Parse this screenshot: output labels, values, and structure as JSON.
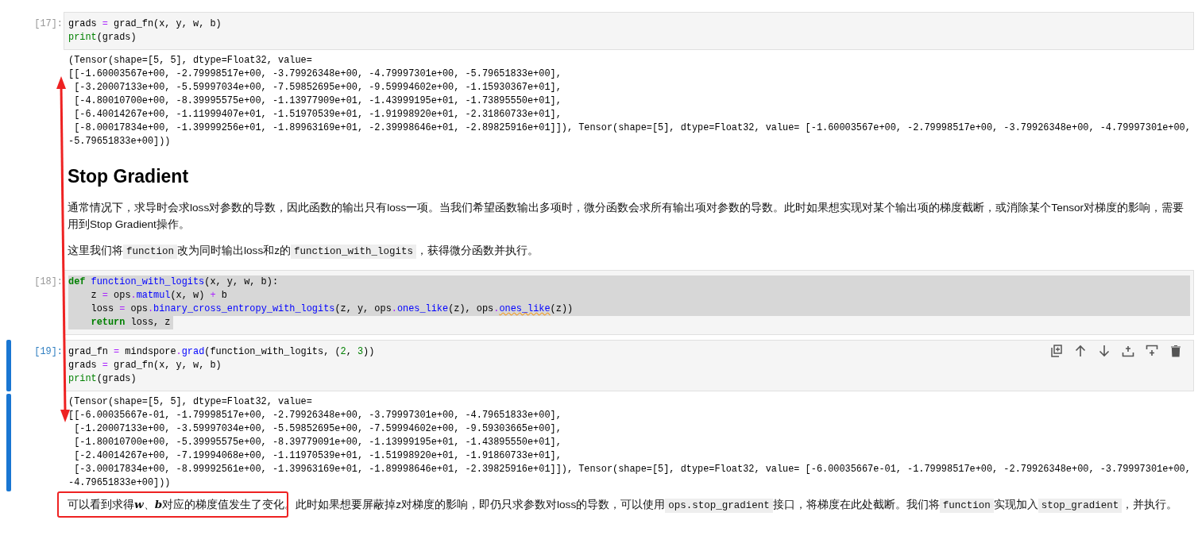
{
  "cells": [
    {
      "kind": "code",
      "prompt": "[17]:",
      "selected": false,
      "text_highlighted": false,
      "lines": [
        [
          {
            "kind": "plain",
            "t": "grads "
          },
          {
            "kind": "op",
            "t": "="
          },
          {
            "kind": "plain",
            "t": " grad_fn(x, y, w, b)"
          }
        ],
        [
          {
            "kind": "builtin",
            "t": "print"
          },
          {
            "kind": "plain",
            "t": "(grads)"
          }
        ]
      ],
      "output": "(Tensor(shape=[5, 5], dtype=Float32, value=\n[[-1.60003567e+00, -2.79998517e+00, -3.79926348e+00, -4.79997301e+00, -5.79651833e+00],\n [-3.20007133e+00, -5.59997034e+00, -7.59852695e+00, -9.59994602e+00, -1.15930367e+01],\n [-4.80010700e+00, -8.39995575e+00, -1.13977909e+01, -1.43999195e+01, -1.73895550e+01],\n [-6.40014267e+00, -1.11999407e+01, -1.51970539e+01, -1.91998920e+01, -2.31860733e+01],\n [-8.00017834e+00, -1.39999256e+01, -1.89963169e+01, -2.39998646e+01, -2.89825916e+01]]), Tensor(shape=[5], dtype=Float32, value= [-1.60003567e+00, -2.79998517e+00, -3.79926348e+00, -4.79997301e+00,\n-5.79651833e+00]))"
    },
    {
      "kind": "heading",
      "text": "Stop Gradient"
    },
    {
      "kind": "paragraph",
      "segments": [
        {
          "kind": "text",
          "text": "通常情况下，求导时会求loss对参数的导数，因此函数的输出只有loss一项。当我们希望函数输出多项时，微分函数会求所有输出项对参数的导数。此时如果想实现对某个输出项的梯度截断，或消除某个Tensor对梯度的影响，需要用到Stop Gradient操作。"
        }
      ]
    },
    {
      "kind": "paragraph",
      "segments": [
        {
          "kind": "text",
          "text": "这里我们将"
        },
        {
          "kind": "code",
          "text": "function"
        },
        {
          "kind": "text",
          "text": "改为同时输出loss和z的"
        },
        {
          "kind": "code",
          "text": "function_with_logits"
        },
        {
          "kind": "text",
          "text": "，获得微分函数并执行。"
        }
      ]
    },
    {
      "kind": "code",
      "prompt": "[18]:",
      "selected": false,
      "text_highlighted": true,
      "lines": [
        [
          {
            "kind": "kw",
            "t": "def "
          },
          {
            "kind": "fn",
            "t": "function_with_logits"
          },
          {
            "kind": "plain",
            "t": "(x, y, w, b):"
          }
        ],
        [
          {
            "kind": "plain",
            "t": "    z "
          },
          {
            "kind": "op",
            "t": "="
          },
          {
            "kind": "plain",
            "t": " ops"
          },
          {
            "kind": "op",
            "t": "."
          },
          {
            "kind": "fn",
            "t": "matmul"
          },
          {
            "kind": "plain",
            "t": "(x, w) "
          },
          {
            "kind": "op",
            "t": "+"
          },
          {
            "kind": "plain",
            "t": " b"
          }
        ],
        [
          {
            "kind": "plain",
            "t": "    loss "
          },
          {
            "kind": "op",
            "t": "="
          },
          {
            "kind": "plain",
            "t": " ops"
          },
          {
            "kind": "op",
            "t": "."
          },
          {
            "kind": "fn",
            "t": "binary_cross_entropy_with_logits"
          },
          {
            "kind": "plain",
            "t": "(z, y, ops"
          },
          {
            "kind": "op",
            "t": "."
          },
          {
            "kind": "fn",
            "t": "ones_like"
          },
          {
            "kind": "plain",
            "t": "(z), ops"
          },
          {
            "kind": "op",
            "t": "."
          },
          {
            "kind": "fn",
            "t": "ones_like",
            "flagged": true
          },
          {
            "kind": "plain",
            "t": "(z))"
          }
        ],
        [
          {
            "kind": "kw",
            "t": "    return"
          },
          {
            "kind": "plain",
            "t": " loss, z"
          }
        ]
      ]
    },
    {
      "kind": "code",
      "prompt": "[19]:",
      "selected": true,
      "text_highlighted": false,
      "lines": [
        [
          {
            "kind": "plain",
            "t": "grad_fn "
          },
          {
            "kind": "op",
            "t": "="
          },
          {
            "kind": "plain",
            "t": " mindspore"
          },
          {
            "kind": "op",
            "t": "."
          },
          {
            "kind": "fn",
            "t": "grad"
          },
          {
            "kind": "plain",
            "t": "(function_with_logits, ("
          },
          {
            "kind": "num",
            "t": "2"
          },
          {
            "kind": "plain",
            "t": ", "
          },
          {
            "kind": "num",
            "t": "3"
          },
          {
            "kind": "plain",
            "t": "))"
          }
        ],
        [
          {
            "kind": "plain",
            "t": "grads "
          },
          {
            "kind": "op",
            "t": "="
          },
          {
            "kind": "plain",
            "t": " grad_fn(x, y, w, b)"
          }
        ],
        [
          {
            "kind": "builtin",
            "t": "print"
          },
          {
            "kind": "plain",
            "t": "(grads)"
          }
        ]
      ],
      "output": "(Tensor(shape=[5, 5], dtype=Float32, value=\n[[-6.00035667e-01, -1.79998517e+00, -2.79926348e+00, -3.79997301e+00, -4.79651833e+00],\n [-1.20007133e+00, -3.59997034e+00, -5.59852695e+00, -7.59994602e+00, -9.59303665e+00],\n [-1.80010700e+00, -5.39995575e+00, -8.39779091e+00, -1.13999195e+01, -1.43895550e+01],\n [-2.40014267e+00, -7.19994068e+00, -1.11970539e+01, -1.51998920e+01, -1.91860733e+01],\n [-3.00017834e+00, -8.99992561e+00, -1.39963169e+01, -1.89998646e+01, -2.39825916e+01]]), Tensor(shape=[5], dtype=Float32, value= [-6.00035667e-01, -1.79998517e+00, -2.79926348e+00, -3.79997301e+00,\n-4.79651833e+00]))"
    },
    {
      "kind": "paragraph",
      "segments": [
        {
          "kind": "text",
          "text": "可以看到求得"
        },
        {
          "kind": "math",
          "text": "w"
        },
        {
          "kind": "text",
          "text": "、"
        },
        {
          "kind": "math",
          "text": "b"
        },
        {
          "kind": "text",
          "text": "对应的梯度值发生了变化。此时如果想要屏蔽掉z对梯度的影响，即仍只求参数对loss的导数，可以使用"
        },
        {
          "kind": "code",
          "text": "ops.stop_gradient"
        },
        {
          "kind": "text",
          "text": "接口，将梯度在此处截断。我们将"
        },
        {
          "kind": "code",
          "text": "function"
        },
        {
          "kind": "text",
          "text": "实现加入"
        },
        {
          "kind": "code",
          "text": "stop_gradient"
        },
        {
          "kind": "text",
          "text": "，并执行。"
        }
      ]
    }
  ]
}
